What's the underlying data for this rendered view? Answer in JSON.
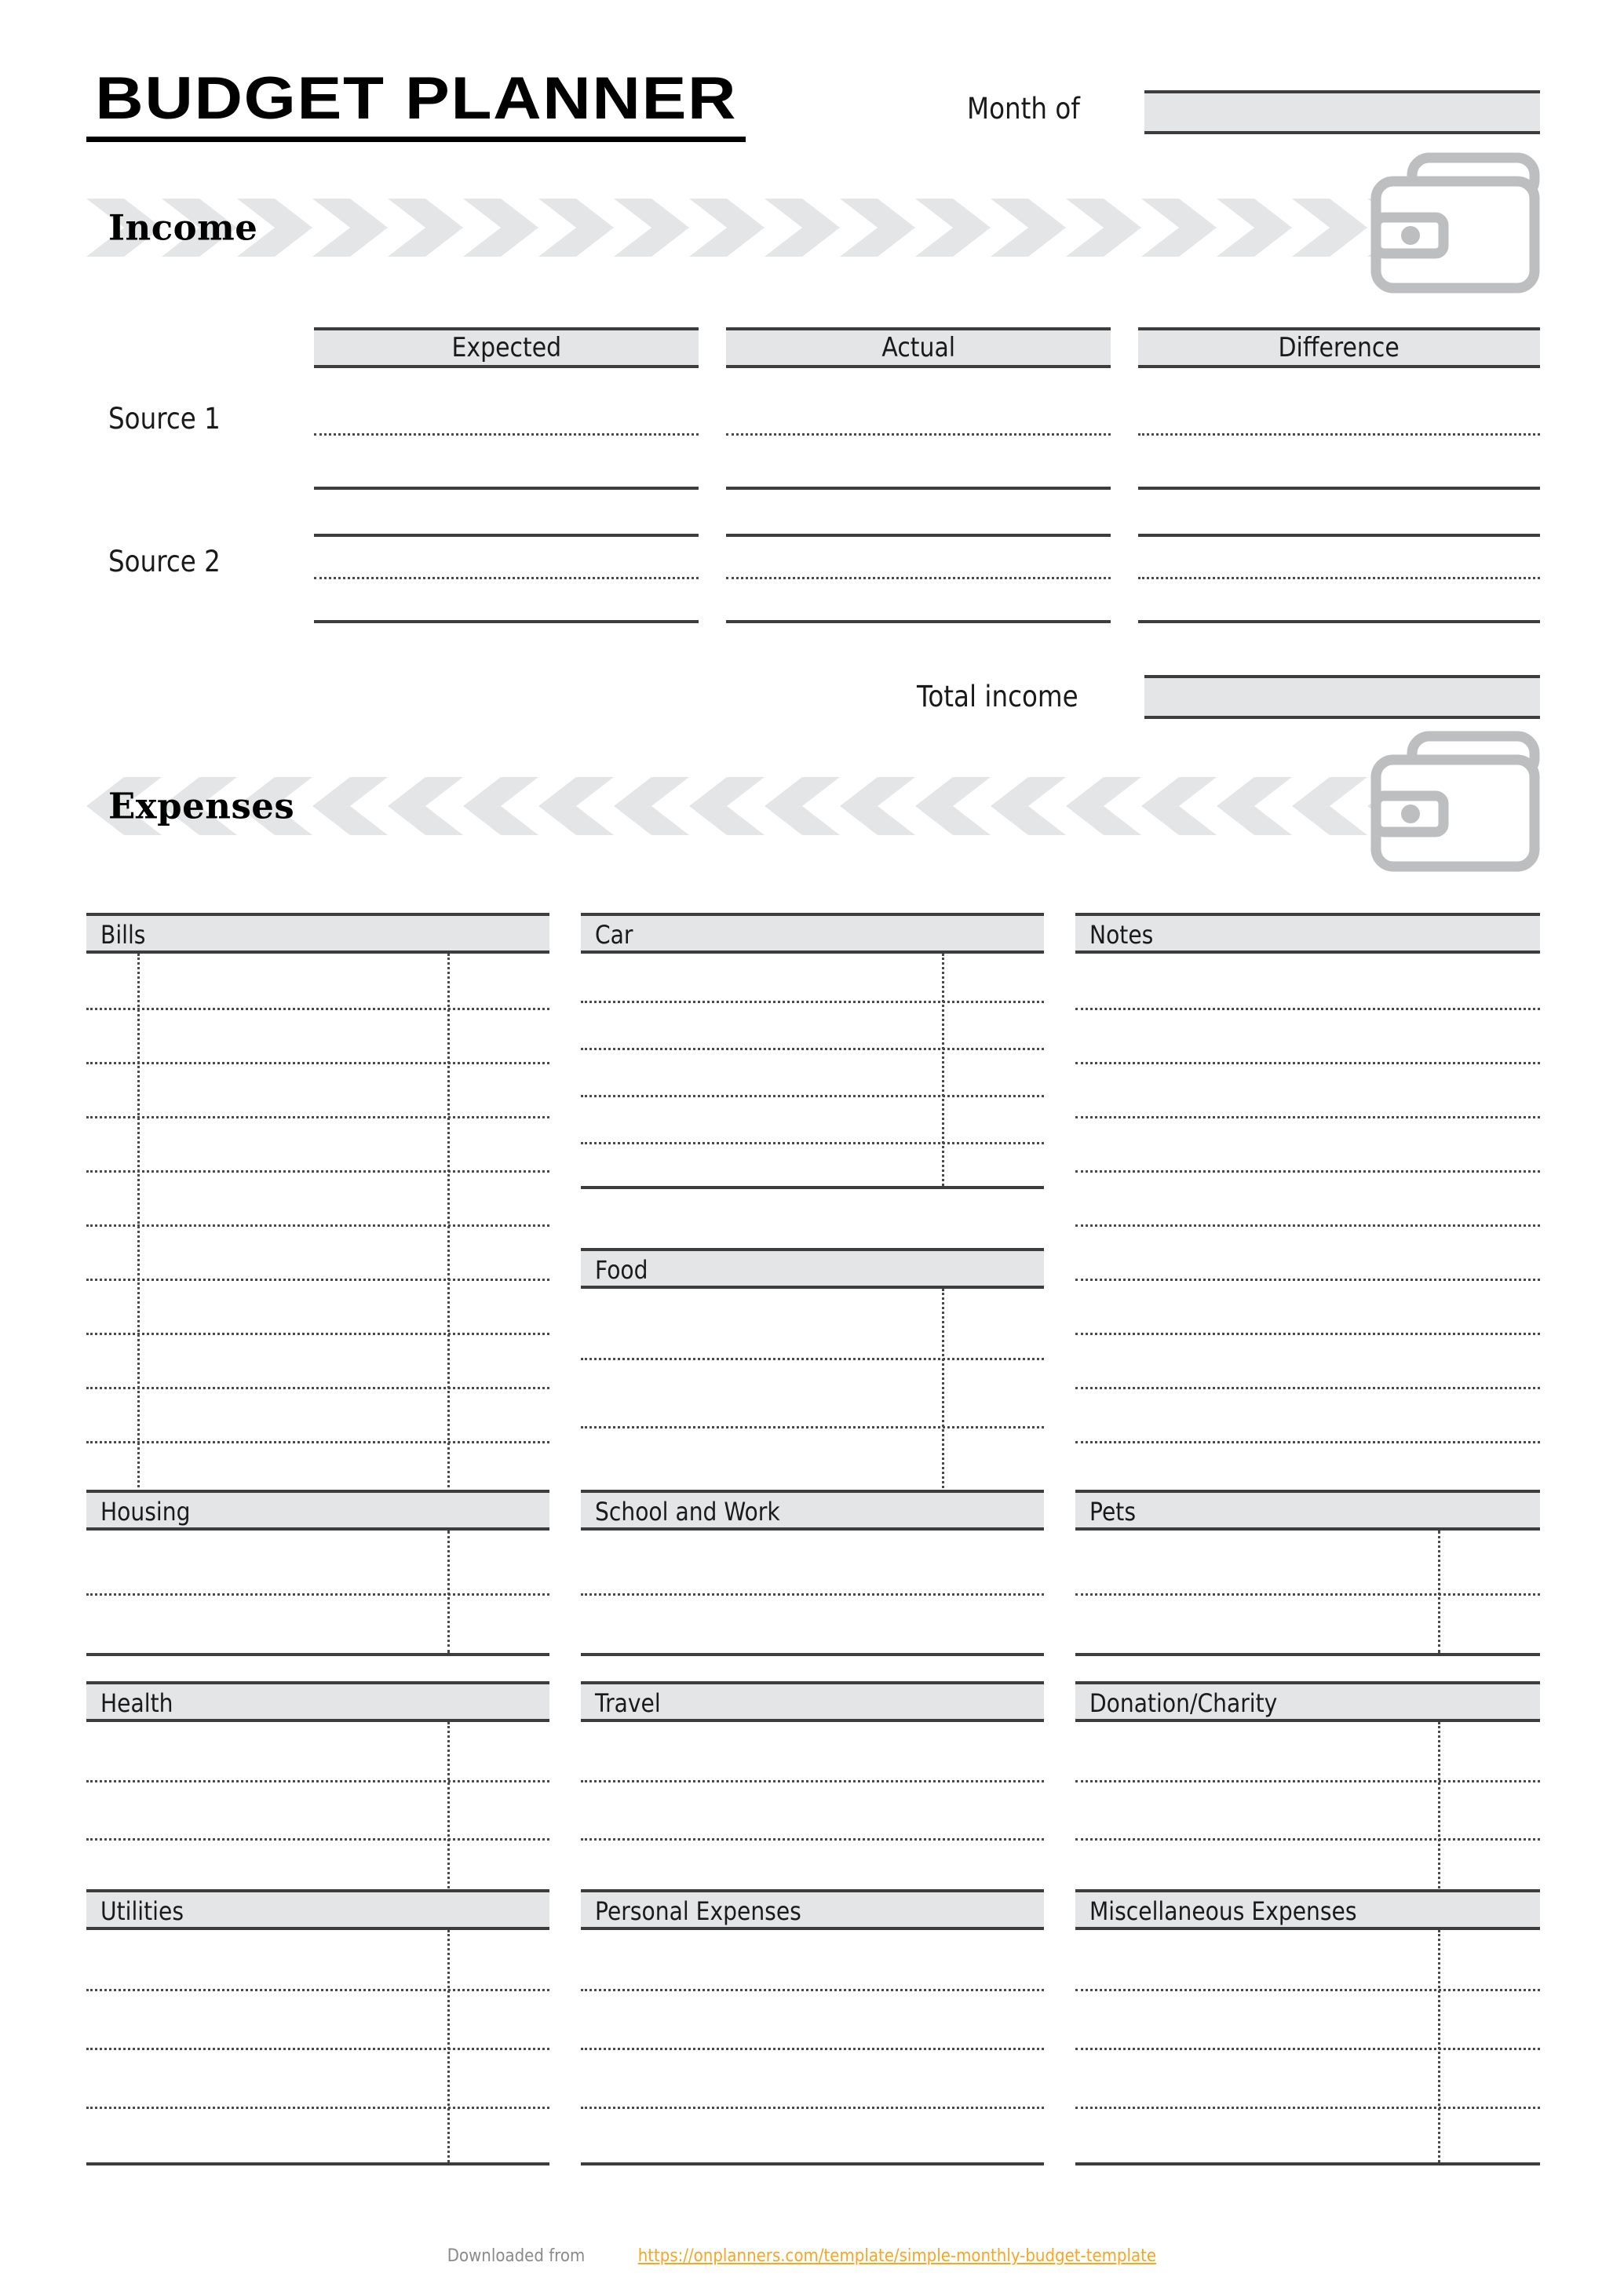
{
  "document": {
    "title": "BUDGET PLANNER"
  },
  "header": {
    "month_label": "Month of",
    "month_value": "",
    "month_placeholder": ""
  },
  "income": {
    "section_title": "Income",
    "wallet_icon": "wallet-icon",
    "columns": [
      "Expected",
      "Actual",
      "Difference"
    ],
    "rows": [
      {
        "label": "Source 1",
        "expected": "",
        "actual": "",
        "difference": ""
      },
      {
        "label": "Source 2",
        "expected": "",
        "actual": "",
        "difference": ""
      }
    ],
    "total_label": "Total income",
    "total_value": ""
  },
  "expenses": {
    "section_title": "Expenses",
    "wallet_icon": "wallet-icon",
    "categories": [
      {
        "name": "Bills",
        "lines": 9,
        "dividers": [
          11,
          78
        ]
      },
      {
        "name": "Car",
        "lines": 4,
        "dividers": [
          78
        ]
      },
      {
        "name": "Notes",
        "lines": 9,
        "dividers": []
      },
      {
        "name": "Food",
        "lines": 2,
        "dividers": [
          78
        ]
      },
      {
        "name": "Housing",
        "lines": 1,
        "dividers": [
          78
        ]
      },
      {
        "name": "School and Work",
        "lines": 1,
        "dividers": []
      },
      {
        "name": "Pets",
        "lines": 1,
        "dividers": [
          78
        ]
      },
      {
        "name": "Health",
        "lines": 2,
        "dividers": [
          78
        ]
      },
      {
        "name": "Travel",
        "lines": 2,
        "dividers": []
      },
      {
        "name": "Donation/Charity",
        "lines": 2,
        "dividers": [
          78
        ]
      },
      {
        "name": "Utilities",
        "lines": 3,
        "dividers": [
          78
        ]
      },
      {
        "name": "Personal Expenses",
        "lines": 3,
        "dividers": []
      },
      {
        "name": "Miscellaneous Expenses",
        "lines": 3,
        "dividers": [
          78
        ]
      }
    ]
  },
  "footer": {
    "prefix": "Downloaded from",
    "url": "https://onplanners.com/template/simple-monthly-budget-template"
  },
  "colors": {
    "band_fill": "#e4e5e6",
    "rule_dark": "#3d3d3d",
    "icon_gray": "#bcbec0",
    "link_orange": "#f5a623",
    "footer_gray": "#8a8a8a"
  }
}
